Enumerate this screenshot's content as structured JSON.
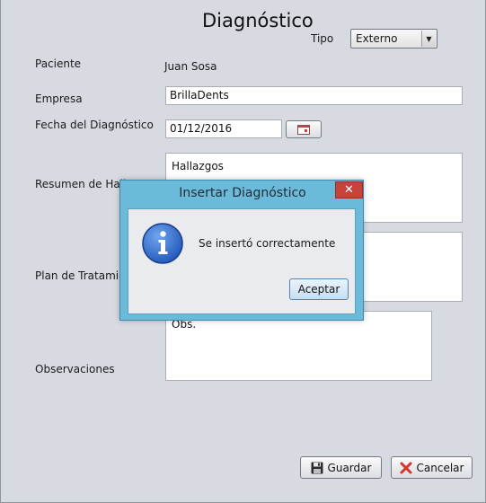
{
  "form": {
    "title": "Diagnóstico",
    "tipo_label": "Tipo",
    "tipo_value": "Externo",
    "paciente_label": "Paciente",
    "paciente_value": "Juan Sosa",
    "empresa_label": "Empresa",
    "empresa_value": "BrillaDents",
    "fecha_label": "Fecha del Diagnóstico",
    "fecha_value": "01/12/2016",
    "resumen_label": "Resumen de Hall",
    "resumen_value": "Hallazgos",
    "plan_label": "Plan de Tratamie",
    "plan_value": "",
    "observaciones_label": "Observaciones",
    "observaciones_value": "Obs."
  },
  "buttons": {
    "guardar": "Guardar",
    "cancelar": "Cancelar"
  },
  "dialog": {
    "title": "Insertar Diagnóstico",
    "message": "Se insertó correctamente",
    "ok": "Aceptar",
    "close": "✕"
  },
  "icons": {
    "info": "info-icon",
    "save": "floppy-disk-icon",
    "cancel": "red-x-icon",
    "calendar": "calendar-icon"
  },
  "colors": {
    "window_bg": "#d8dae2",
    "dialog_frame": "#6cbad9",
    "close_button": "#c7423a",
    "info_icon": "#2a63c6"
  }
}
